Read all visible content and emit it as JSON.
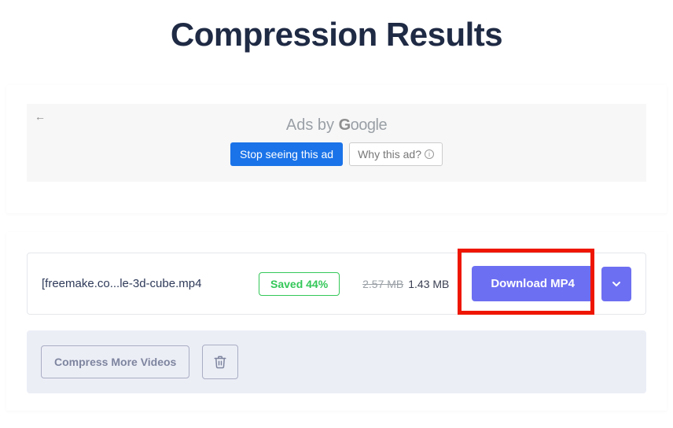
{
  "title": "Compression Results",
  "ad": {
    "ads_by_prefix": "Ads by ",
    "google_logo_text": "Google",
    "stop_label": "Stop seeing this ad",
    "why_label": "Why this ad?"
  },
  "result": {
    "file_name": "[freemake.co...le-3d-cube.mp4",
    "saved_label": "Saved 44%",
    "old_size": "2.57 MB",
    "new_size": "1.43 MB",
    "download_label": "Download MP4"
  },
  "footer": {
    "compress_more_label": "Compress More Videos"
  }
}
